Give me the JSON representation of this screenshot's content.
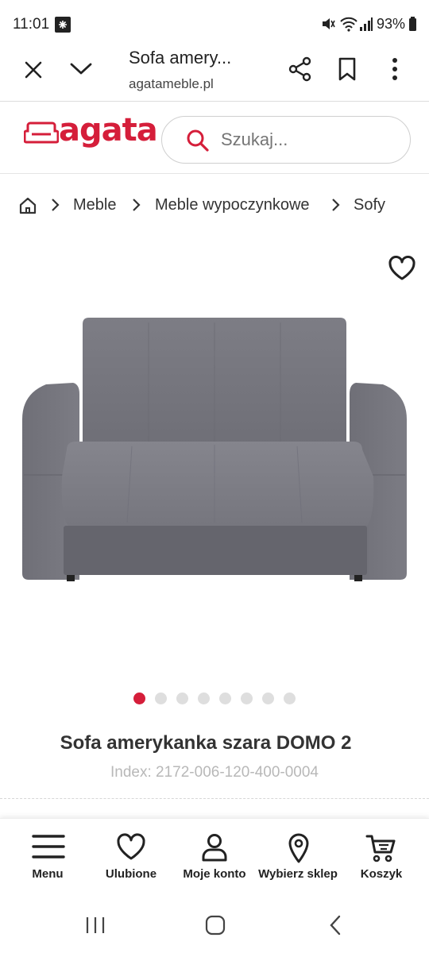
{
  "status_bar": {
    "time": "11:01",
    "battery": "93%"
  },
  "browser": {
    "title": "Sofa amery...",
    "url": "agatameble.pl"
  },
  "site": {
    "logo_text": "agata",
    "brand_color": "#d51e3a",
    "search_placeholder": "Szukaj..."
  },
  "breadcrumb": {
    "items": [
      "Meble",
      "Meble wypoczynkowe",
      "Sofy"
    ]
  },
  "product": {
    "title": "Sofa amerykanka szara DOMO 2",
    "index": "Index: 2172-006-120-400-0004",
    "image_count": 8,
    "active_image": 1
  },
  "bottom_nav": {
    "items": [
      {
        "label": "Menu",
        "icon": "hamburger-icon"
      },
      {
        "label": "Ulubione",
        "icon": "heart-icon"
      },
      {
        "label": "Moje konto",
        "icon": "user-icon"
      },
      {
        "label": "Wybierz sklep",
        "icon": "map-pin-icon"
      },
      {
        "label": "Koszyk",
        "icon": "cart-icon"
      }
    ]
  }
}
